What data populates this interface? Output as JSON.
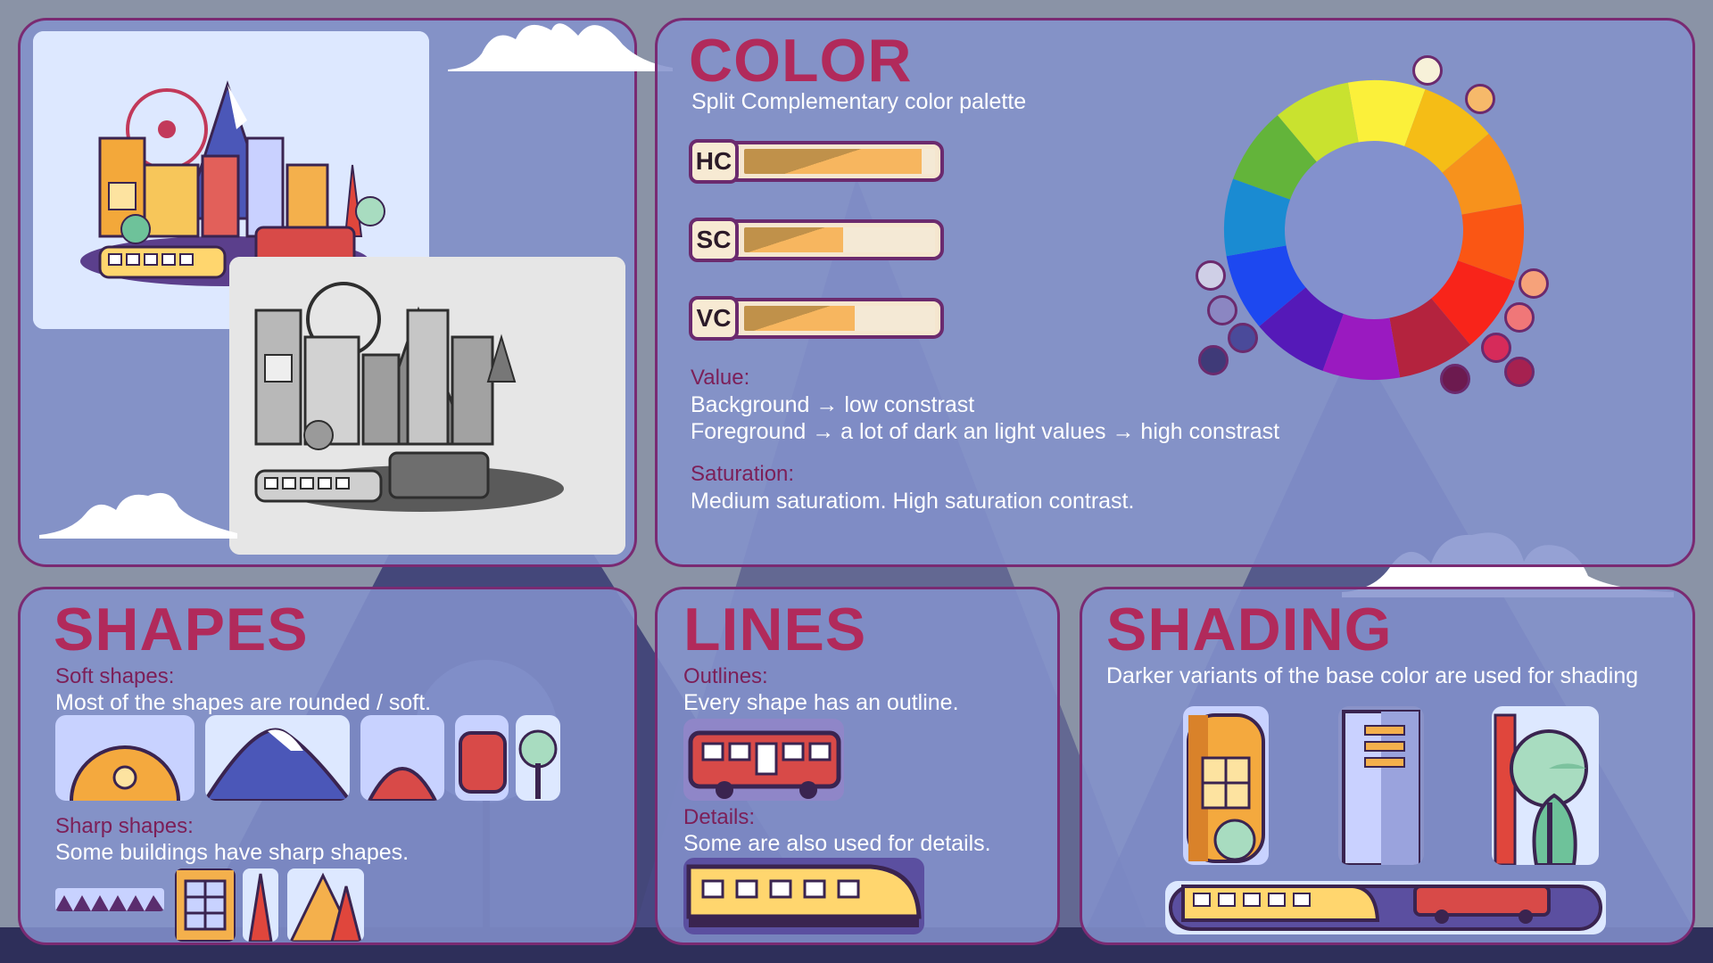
{
  "background": {
    "color": "#8a93a6",
    "accent": "#b12a5b"
  },
  "color_panel": {
    "title": "COLOR",
    "subtitle": "Split Complementary color palette",
    "meters": [
      {
        "label": "HC",
        "level": 0.93
      },
      {
        "label": "SC",
        "level": 0.52
      },
      {
        "label": "VC",
        "level": 0.58
      }
    ],
    "value_label": "Value:",
    "value_lines": [
      "Background → low constrast",
      "Foreground → a lot of dark an light values → high constrast"
    ],
    "saturation_label": "Saturation:",
    "saturation_text": "Medium saturatiom. High saturation contrast.",
    "wheel_colors": [
      "#fbf03a",
      "#f5bd16",
      "#f7921c",
      "#fa5614",
      "#f8241a",
      "#b4233e",
      "#9a1ac0",
      "#5519b8",
      "#1d48f0",
      "#1a8bd2",
      "#63b43a",
      "#c9e22f"
    ],
    "scheme_swatches_top": [
      "#f7f1d9",
      "#f6b96a"
    ],
    "scheme_swatches_left": [
      "#cfcfe6",
      "#8b86c2",
      "#4a4a9a",
      "#3f3a78"
    ],
    "scheme_swatches_right": [
      "#f6a27a",
      "#f07778",
      "#d62b5a",
      "#a62150",
      "#6c1a4f"
    ]
  },
  "shapes_panel": {
    "title": "SHAPES",
    "soft_label": "Soft shapes:",
    "soft_text": "Most of the shapes are rounded / soft.",
    "sharp_label": "Sharp shapes:",
    "sharp_text": "Some buildings have sharp shapes."
  },
  "lines_panel": {
    "title": "LINES",
    "outlines_label": "Outlines:",
    "outlines_text": "Every shape has an outline.",
    "details_label": "Details:",
    "details_text": "Some are also used for details."
  },
  "shading_panel": {
    "title": "SHADING",
    "text": "Darker variants of the base color are used for shading"
  }
}
